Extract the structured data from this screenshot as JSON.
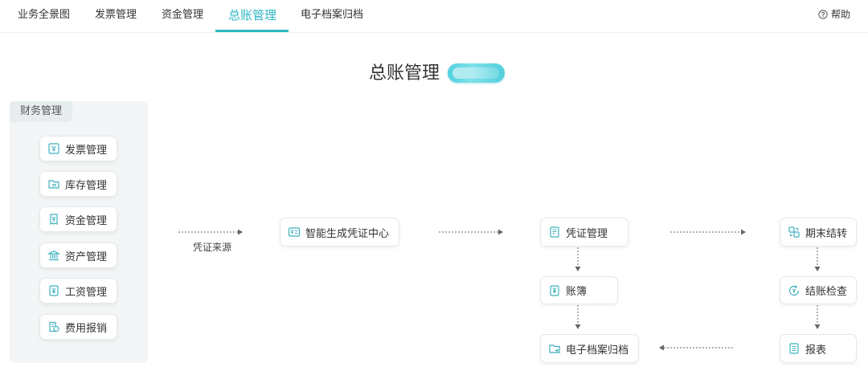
{
  "nav": {
    "tabs": [
      {
        "label": "业务全景图"
      },
      {
        "label": "发票管理"
      },
      {
        "label": "资金管理"
      },
      {
        "label": "总账管理",
        "active": true
      },
      {
        "label": "电子档案归档"
      }
    ],
    "help_label": "帮助"
  },
  "page": {
    "title": "总账管理"
  },
  "finance_panel": {
    "label": "财务管理",
    "items": [
      {
        "label": "发票管理",
        "icon": "invoice-icon"
      },
      {
        "label": "库存管理",
        "icon": "inventory-icon"
      },
      {
        "label": "资金管理",
        "icon": "funds-icon"
      },
      {
        "label": "资产管理",
        "icon": "bank-icon"
      },
      {
        "label": "工资管理",
        "icon": "salary-icon"
      },
      {
        "label": "费用报销",
        "icon": "reimbursement-icon"
      }
    ]
  },
  "flow": {
    "source_label": "凭证来源",
    "nodes": {
      "voucher_center": {
        "label": "智能生成凭证中心",
        "icon": "voucher-center-icon"
      },
      "voucher_mgmt": {
        "label": "凭证管理",
        "icon": "voucher-icon"
      },
      "ledger": {
        "label": "账簿",
        "icon": "ledger-icon"
      },
      "archive": {
        "label": "电子档案归档",
        "icon": "archive-icon"
      },
      "period_close": {
        "label": "期末结转",
        "icon": "transfer-icon"
      },
      "close_check": {
        "label": "结账检查",
        "icon": "check-icon"
      },
      "report": {
        "label": "报表",
        "icon": "report-icon"
      }
    }
  },
  "colors": {
    "accent": "#2fb7c4",
    "icon": "#3fb0bd",
    "arrow": "#666666"
  }
}
